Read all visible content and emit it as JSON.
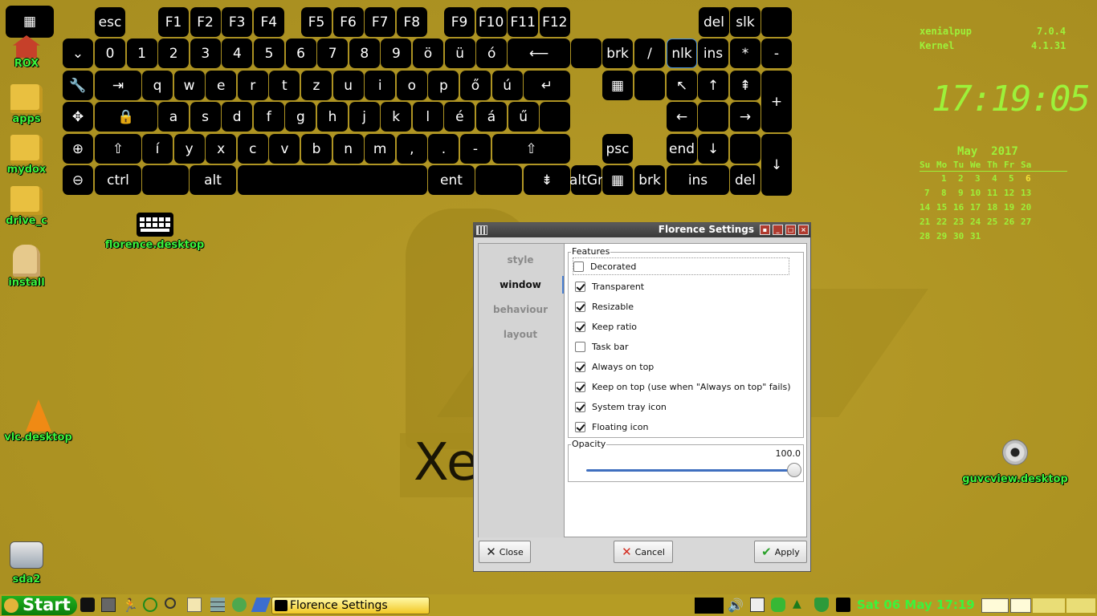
{
  "keyboard": {
    "row0": [
      "esc",
      "F1",
      "F2",
      "F3",
      "F4",
      "F5",
      "F6",
      "F7",
      "F8",
      "F9",
      "F10",
      "F11",
      "F12",
      "del",
      "slk"
    ],
    "row1": [
      "0",
      "1",
      "2",
      "3",
      "4",
      "5",
      "6",
      "7",
      "8",
      "9",
      "ö",
      "ü",
      "ó",
      "brk",
      "/",
      "nlk",
      "ins",
      "*",
      "-"
    ],
    "row2": [
      "q",
      "w",
      "e",
      "r",
      "t",
      "z",
      "u",
      "i",
      "o",
      "p",
      "ő",
      "ú",
      "+"
    ],
    "row3": [
      "a",
      "s",
      "d",
      "f",
      "g",
      "h",
      "j",
      "k",
      "l",
      "é",
      "á",
      "ű"
    ],
    "row4": [
      "í",
      "y",
      "x",
      "c",
      "v",
      "b",
      "n",
      "m",
      ",",
      ".",
      "-",
      "psc",
      "end"
    ],
    "row5": [
      "ctrl",
      "alt",
      "ent",
      "altGr",
      "brk",
      "ins",
      "del"
    ]
  },
  "desktop_icons": [
    "ROX",
    "apps",
    "mydox",
    "drive_c",
    "install",
    "florence.desktop",
    "vlc.desktop",
    "sda2",
    "guvcview.desktop"
  ],
  "conky": {
    "distro": "xenialpup",
    "distro_version": "7.0.4",
    "kernel_label": "Kernel",
    "kernel_version": "4.1.31",
    "clock": "17:19:05",
    "calendar_title": "May  2017",
    "weekdays": [
      "Su",
      "Mo",
      "Tu",
      "We",
      "Th",
      "Fr",
      "Sa"
    ],
    "weeks": [
      [
        "",
        "1",
        "2",
        "3",
        "4",
        "5",
        "6"
      ],
      [
        "7",
        "8",
        "9",
        "10",
        "11",
        "12",
        "13"
      ],
      [
        "14",
        "15",
        "16",
        "17",
        "18",
        "19",
        "20"
      ],
      [
        "21",
        "22",
        "23",
        "24",
        "25",
        "26",
        "27"
      ],
      [
        "28",
        "29",
        "30",
        "31",
        "",
        "",
        ""
      ]
    ]
  },
  "settings": {
    "title": "Florence Settings",
    "tabs": [
      "style",
      "window",
      "behaviour",
      "layout"
    ],
    "features_title": "Features",
    "features": [
      {
        "label": "Decorated",
        "checked": false
      },
      {
        "label": "Transparent",
        "checked": true
      },
      {
        "label": "Resizable",
        "checked": true
      },
      {
        "label": "Keep ratio",
        "checked": true
      },
      {
        "label": "Task bar",
        "checked": false
      },
      {
        "label": "Always on top",
        "checked": true
      },
      {
        "label": "Keep on top (use when \"Always on top\" fails)",
        "checked": true
      },
      {
        "label": "System tray icon",
        "checked": true
      },
      {
        "label": "Floating icon",
        "checked": true
      }
    ],
    "opacity_title": "Opacity",
    "opacity_value": "100.0",
    "close_label": "Close",
    "cancel_label": "Cancel",
    "apply_label": "Apply"
  },
  "taskbar": {
    "start_label": "Start",
    "task_label": "Florence Settings",
    "datetime": "Sat 06 May 17:19"
  },
  "colors": {
    "desktop": "#b59a26",
    "label_green": "#3cf33c",
    "conky_green": "#9df13a"
  }
}
